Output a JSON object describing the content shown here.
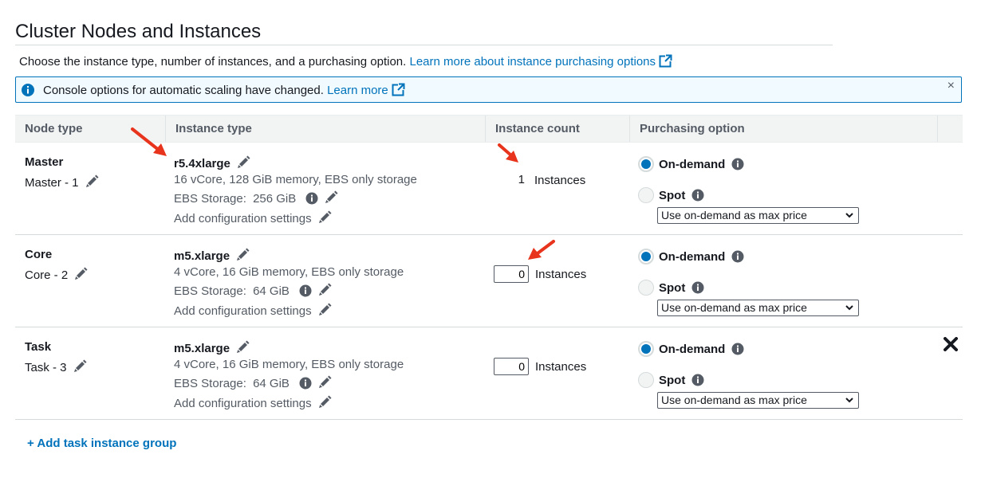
{
  "section": {
    "title": "Cluster Nodes and Instances",
    "description": "Choose the instance type, number of instances, and a purchasing option.",
    "learn_more_link": "Learn more about instance purchasing options"
  },
  "alert": {
    "text": "Console options for automatic scaling have changed.",
    "link": "Learn more",
    "close": "×"
  },
  "table": {
    "headers": [
      "Node type",
      "Instance type",
      "Instance count",
      "Purchasing option"
    ],
    "rows": [
      {
        "node": "Master",
        "node_sub": "Master - 1",
        "instance_type": "r5.4xlarge",
        "spec": "16 vCore, 128 GiB memory, EBS only storage",
        "ebs_label": "EBS Storage:",
        "ebs_value": "256 GiB",
        "config": "Add configuration settings",
        "count": "1",
        "count_label": "Instances",
        "on_demand": "On-demand",
        "spot": "Spot",
        "select": "Use on-demand as max price"
      },
      {
        "node": "Core",
        "node_sub": "Core - 2",
        "instance_type": "m5.xlarge",
        "spec": "4 vCore, 16 GiB memory, EBS only storage",
        "ebs_label": "EBS Storage:",
        "ebs_value": "64 GiB",
        "config": "Add configuration settings",
        "count": "0",
        "count_label": "Instances",
        "on_demand": "On-demand",
        "spot": "Spot",
        "select": "Use on-demand as max price"
      },
      {
        "node": "Task",
        "node_sub": "Task - 3",
        "instance_type": "m5.xlarge",
        "spec": "4 vCore, 16 GiB memory, EBS only storage",
        "ebs_label": "EBS Storage:",
        "ebs_value": "64 GiB",
        "config": "Add configuration settings",
        "count": "0",
        "count_label": "Instances",
        "on_demand": "On-demand",
        "spot": "Spot",
        "select": "Use on-demand as max price"
      }
    ]
  },
  "add_group": "+ Add task instance group",
  "colors": {
    "link": "#0073bb",
    "alert_border": "#0073bb",
    "alert_bg": "#f1faff",
    "annotation_arrow": "#e8341c"
  }
}
